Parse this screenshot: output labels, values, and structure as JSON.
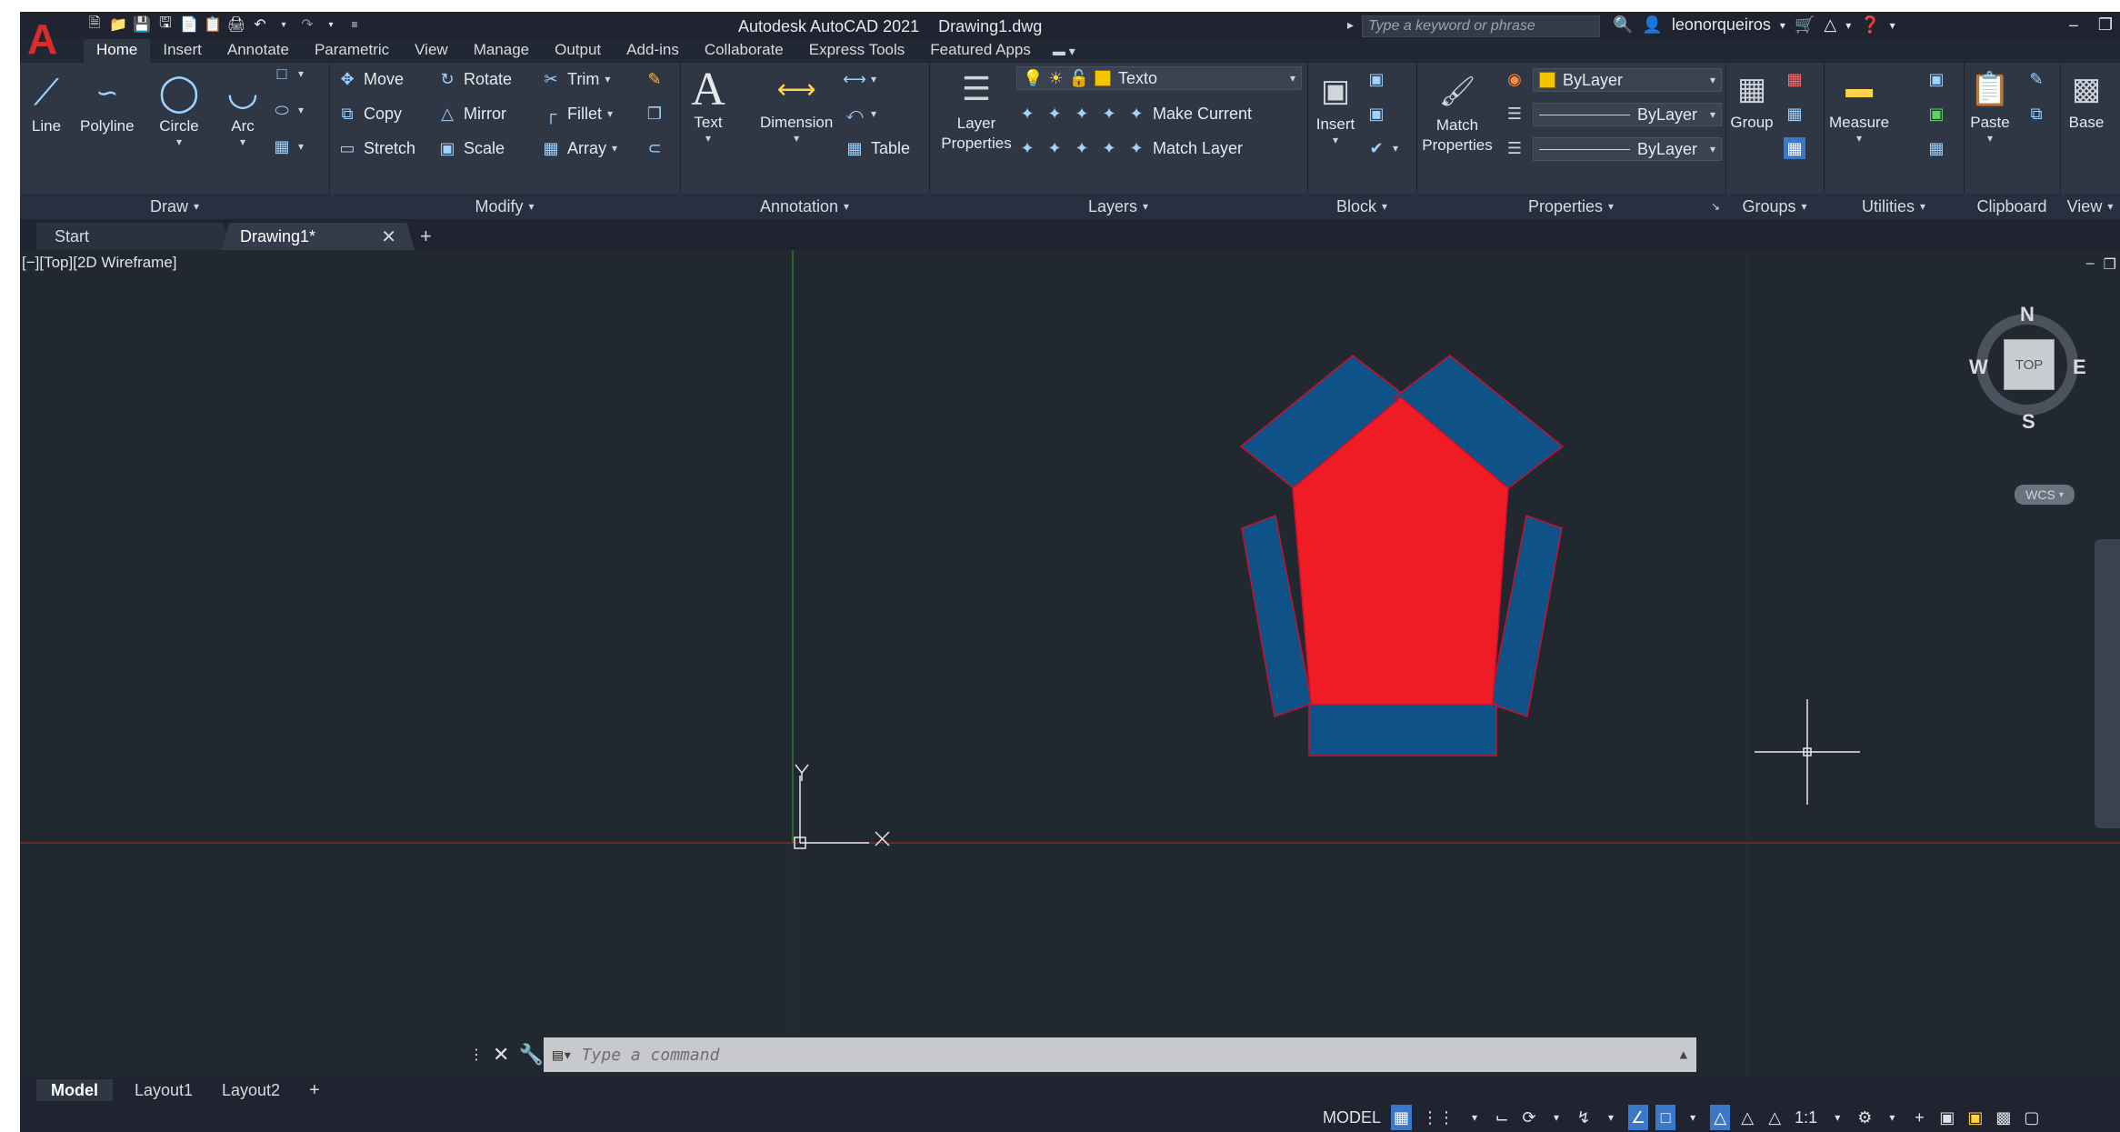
{
  "app": {
    "title": "Autodesk AutoCAD 2021",
    "document": "Drawing1.dwg",
    "logo_letter": "A",
    "search_placeholder": "Type a keyword or phrase",
    "user": "leonorqueiros"
  },
  "ribbon_tabs": [
    "Home",
    "Insert",
    "Annotate",
    "Parametric",
    "View",
    "Manage",
    "Output",
    "Add-ins",
    "Collaborate",
    "Express Tools",
    "Featured Apps"
  ],
  "panels": {
    "draw": {
      "label": "Draw",
      "tools": [
        "Line",
        "Polyline",
        "Circle",
        "Arc"
      ]
    },
    "modify": {
      "label": "Modify",
      "tools": [
        "Move",
        "Rotate",
        "Trim",
        "Copy",
        "Mirror",
        "Fillet",
        "Stretch",
        "Scale",
        "Array"
      ]
    },
    "annotation": {
      "label": "Annotation",
      "text": "Text",
      "dimension": "Dimension",
      "table": "Table"
    },
    "layers": {
      "label": "Layers",
      "layer_properties": "Layer Properties",
      "current_layer": "Texto",
      "make_current": "Make Current",
      "match_layer": "Match Layer"
    },
    "block": {
      "label": "Block",
      "insert": "Insert"
    },
    "properties": {
      "label": "Properties",
      "match_properties": "Match Properties",
      "color": "ByLayer",
      "linetype": "ByLayer",
      "lineweight": "ByLayer"
    },
    "groups": {
      "label": "Groups",
      "group": "Group"
    },
    "utilities": {
      "label": "Utilities",
      "measure": "Measure"
    },
    "clipboard": {
      "label": "Clipboard",
      "paste": "Paste"
    },
    "view": {
      "label": "View",
      "base": "Base"
    }
  },
  "file_tabs": {
    "start": "Start",
    "drawing": "Drawing1*"
  },
  "viewport": {
    "label": "[−][Top][2D Wireframe]",
    "viewcube": {
      "n": "N",
      "s": "S",
      "e": "E",
      "w": "W",
      "top": "TOP"
    },
    "wcs": "WCS",
    "ucs": {
      "x": "X",
      "y": "Y"
    }
  },
  "command_line": {
    "placeholder": "Type a command"
  },
  "layout_tabs": [
    "Model",
    "Layout1",
    "Layout2"
  ],
  "status": {
    "model": "MODEL",
    "scale": "1:1"
  },
  "colors": {
    "pentagon_fill": "#ef1c25",
    "rect_fill": "#0f5288",
    "outline": "#c8102e",
    "x_axis": "#8a2b2b",
    "y_axis": "#2f7a32"
  }
}
